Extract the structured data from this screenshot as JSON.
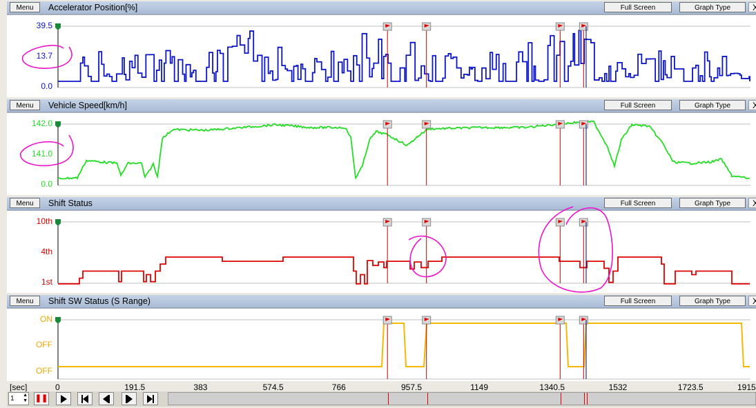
{
  "panels": [
    {
      "menu": "Menu",
      "title": "Accelerator Position[%]",
      "full_screen": "Full Screen",
      "graph_type": "Graph Type",
      "close": "X",
      "y_ticks": [
        "39.5",
        "13.7",
        "0.0"
      ],
      "color": "#0a14c8"
    },
    {
      "menu": "Menu",
      "title": "Vehicle Speed[km/h]",
      "full_screen": "Full Screen",
      "graph_type": "Graph Type",
      "close": "X",
      "y_ticks": [
        "142.0",
        "141.0",
        "0.0"
      ],
      "color": "#22dd22"
    },
    {
      "menu": "Menu",
      "title": "Shift Status",
      "full_screen": "Full Screen",
      "graph_type": "Graph Type",
      "close": "X",
      "y_ticks": [
        "10th",
        "4th",
        "1st"
      ],
      "color": "#dd0000"
    },
    {
      "menu": "Menu",
      "title": "Shift SW Status (S Range)",
      "full_screen": "Full Screen",
      "graph_type": "Graph Type",
      "close": "X",
      "y_ticks": [
        "ON",
        "OFF",
        "OFF"
      ],
      "color": "#f5b800"
    }
  ],
  "x_axis": {
    "unit": "[sec]",
    "ticks": [
      "0",
      "191.5",
      "383",
      "574.5",
      "766",
      "957.5",
      "1149",
      "1340.5",
      "1532",
      "1723.5",
      "1915"
    ],
    "max": 1915
  },
  "markers_sec": [
    912,
    1020,
    1390,
    1455,
    1462
  ],
  "controls": {
    "step_value": "1",
    "icons": [
      "pause-icon",
      "play-icon",
      "skip-start-icon",
      "step-back-icon",
      "step-forward-icon",
      "skip-end-icon"
    ]
  },
  "annotation_color": "#ee11cc"
}
